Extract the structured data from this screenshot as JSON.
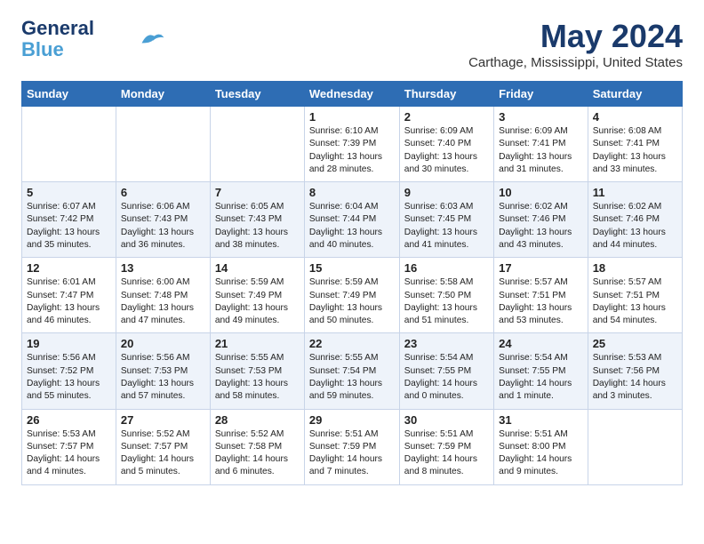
{
  "logo": {
    "line1": "General",
    "line2": "Blue"
  },
  "title": "May 2024",
  "subtitle": "Carthage, Mississippi, United States",
  "days_header": [
    "Sunday",
    "Monday",
    "Tuesday",
    "Wednesday",
    "Thursday",
    "Friday",
    "Saturday"
  ],
  "weeks": [
    [
      {
        "num": "",
        "text": ""
      },
      {
        "num": "",
        "text": ""
      },
      {
        "num": "",
        "text": ""
      },
      {
        "num": "1",
        "text": "Sunrise: 6:10 AM\nSunset: 7:39 PM\nDaylight: 13 hours\nand 28 minutes."
      },
      {
        "num": "2",
        "text": "Sunrise: 6:09 AM\nSunset: 7:40 PM\nDaylight: 13 hours\nand 30 minutes."
      },
      {
        "num": "3",
        "text": "Sunrise: 6:09 AM\nSunset: 7:41 PM\nDaylight: 13 hours\nand 31 minutes."
      },
      {
        "num": "4",
        "text": "Sunrise: 6:08 AM\nSunset: 7:41 PM\nDaylight: 13 hours\nand 33 minutes."
      }
    ],
    [
      {
        "num": "5",
        "text": "Sunrise: 6:07 AM\nSunset: 7:42 PM\nDaylight: 13 hours\nand 35 minutes."
      },
      {
        "num": "6",
        "text": "Sunrise: 6:06 AM\nSunset: 7:43 PM\nDaylight: 13 hours\nand 36 minutes."
      },
      {
        "num": "7",
        "text": "Sunrise: 6:05 AM\nSunset: 7:43 PM\nDaylight: 13 hours\nand 38 minutes."
      },
      {
        "num": "8",
        "text": "Sunrise: 6:04 AM\nSunset: 7:44 PM\nDaylight: 13 hours\nand 40 minutes."
      },
      {
        "num": "9",
        "text": "Sunrise: 6:03 AM\nSunset: 7:45 PM\nDaylight: 13 hours\nand 41 minutes."
      },
      {
        "num": "10",
        "text": "Sunrise: 6:02 AM\nSunset: 7:46 PM\nDaylight: 13 hours\nand 43 minutes."
      },
      {
        "num": "11",
        "text": "Sunrise: 6:02 AM\nSunset: 7:46 PM\nDaylight: 13 hours\nand 44 minutes."
      }
    ],
    [
      {
        "num": "12",
        "text": "Sunrise: 6:01 AM\nSunset: 7:47 PM\nDaylight: 13 hours\nand 46 minutes."
      },
      {
        "num": "13",
        "text": "Sunrise: 6:00 AM\nSunset: 7:48 PM\nDaylight: 13 hours\nand 47 minutes."
      },
      {
        "num": "14",
        "text": "Sunrise: 5:59 AM\nSunset: 7:49 PM\nDaylight: 13 hours\nand 49 minutes."
      },
      {
        "num": "15",
        "text": "Sunrise: 5:59 AM\nSunset: 7:49 PM\nDaylight: 13 hours\nand 50 minutes."
      },
      {
        "num": "16",
        "text": "Sunrise: 5:58 AM\nSunset: 7:50 PM\nDaylight: 13 hours\nand 51 minutes."
      },
      {
        "num": "17",
        "text": "Sunrise: 5:57 AM\nSunset: 7:51 PM\nDaylight: 13 hours\nand 53 minutes."
      },
      {
        "num": "18",
        "text": "Sunrise: 5:57 AM\nSunset: 7:51 PM\nDaylight: 13 hours\nand 54 minutes."
      }
    ],
    [
      {
        "num": "19",
        "text": "Sunrise: 5:56 AM\nSunset: 7:52 PM\nDaylight: 13 hours\nand 55 minutes."
      },
      {
        "num": "20",
        "text": "Sunrise: 5:56 AM\nSunset: 7:53 PM\nDaylight: 13 hours\nand 57 minutes."
      },
      {
        "num": "21",
        "text": "Sunrise: 5:55 AM\nSunset: 7:53 PM\nDaylight: 13 hours\nand 58 minutes."
      },
      {
        "num": "22",
        "text": "Sunrise: 5:55 AM\nSunset: 7:54 PM\nDaylight: 13 hours\nand 59 minutes."
      },
      {
        "num": "23",
        "text": "Sunrise: 5:54 AM\nSunset: 7:55 PM\nDaylight: 14 hours\nand 0 minutes."
      },
      {
        "num": "24",
        "text": "Sunrise: 5:54 AM\nSunset: 7:55 PM\nDaylight: 14 hours\nand 1 minute."
      },
      {
        "num": "25",
        "text": "Sunrise: 5:53 AM\nSunset: 7:56 PM\nDaylight: 14 hours\nand 3 minutes."
      }
    ],
    [
      {
        "num": "26",
        "text": "Sunrise: 5:53 AM\nSunset: 7:57 PM\nDaylight: 14 hours\nand 4 minutes."
      },
      {
        "num": "27",
        "text": "Sunrise: 5:52 AM\nSunset: 7:57 PM\nDaylight: 14 hours\nand 5 minutes."
      },
      {
        "num": "28",
        "text": "Sunrise: 5:52 AM\nSunset: 7:58 PM\nDaylight: 14 hours\nand 6 minutes."
      },
      {
        "num": "29",
        "text": "Sunrise: 5:51 AM\nSunset: 7:59 PM\nDaylight: 14 hours\nand 7 minutes."
      },
      {
        "num": "30",
        "text": "Sunrise: 5:51 AM\nSunset: 7:59 PM\nDaylight: 14 hours\nand 8 minutes."
      },
      {
        "num": "31",
        "text": "Sunrise: 5:51 AM\nSunset: 8:00 PM\nDaylight: 14 hours\nand 9 minutes."
      },
      {
        "num": "",
        "text": ""
      }
    ]
  ]
}
